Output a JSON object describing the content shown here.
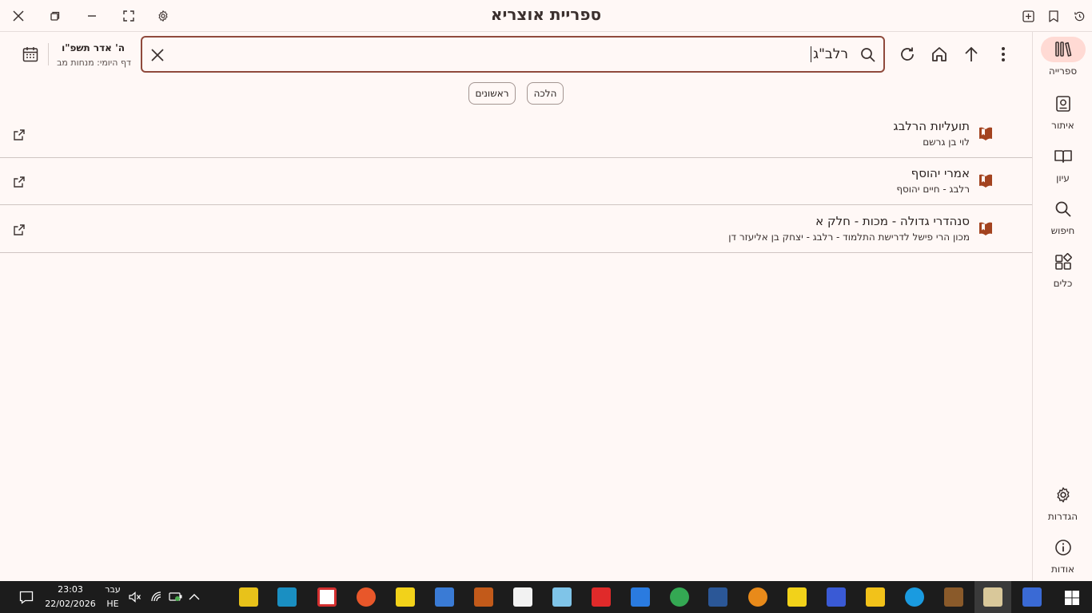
{
  "window": {
    "title": "ספריית אוצריא"
  },
  "rail": {
    "items": [
      {
        "label": "ספרייה",
        "icon": "library-icon",
        "active": true
      },
      {
        "label": "איתור",
        "icon": "find-book-icon"
      },
      {
        "label": "עיון",
        "icon": "open-book-icon"
      },
      {
        "label": "חיפוש",
        "icon": "search-icon"
      },
      {
        "label": "כלים",
        "icon": "tools-icon"
      }
    ],
    "bottom": [
      {
        "label": "הגדרות",
        "icon": "settings-icon"
      },
      {
        "label": "אודות",
        "icon": "info-icon"
      }
    ]
  },
  "search": {
    "value": "רלב\"ג"
  },
  "calendar": {
    "hebrew_date": "ה' אדר תשפ\"ו",
    "daf": "דף היומי: מנחות מב"
  },
  "filters": {
    "chips": [
      "הלכה",
      "ראשונים"
    ]
  },
  "results": [
    {
      "title": "תועליות הרלבג",
      "subtitle": "לוי בן גרשם"
    },
    {
      "title": "אמרי יהוסף",
      "subtitle": "רלבג - חיים יהוסף"
    },
    {
      "title": "סנהדרי גדולה - מכות - חלק א",
      "subtitle": "מכון הרי פישל לדרישת התלמוד - רלבג - יצחק בן אליעזר דן"
    }
  ],
  "taskbar": {
    "time": "23:03",
    "date": "22/02/2026",
    "lang_top": "עבר",
    "lang_bottom": "HE"
  },
  "colors": {
    "accent": "#8f4a3c",
    "book": "#a3431f",
    "background": "#fff8f6"
  }
}
